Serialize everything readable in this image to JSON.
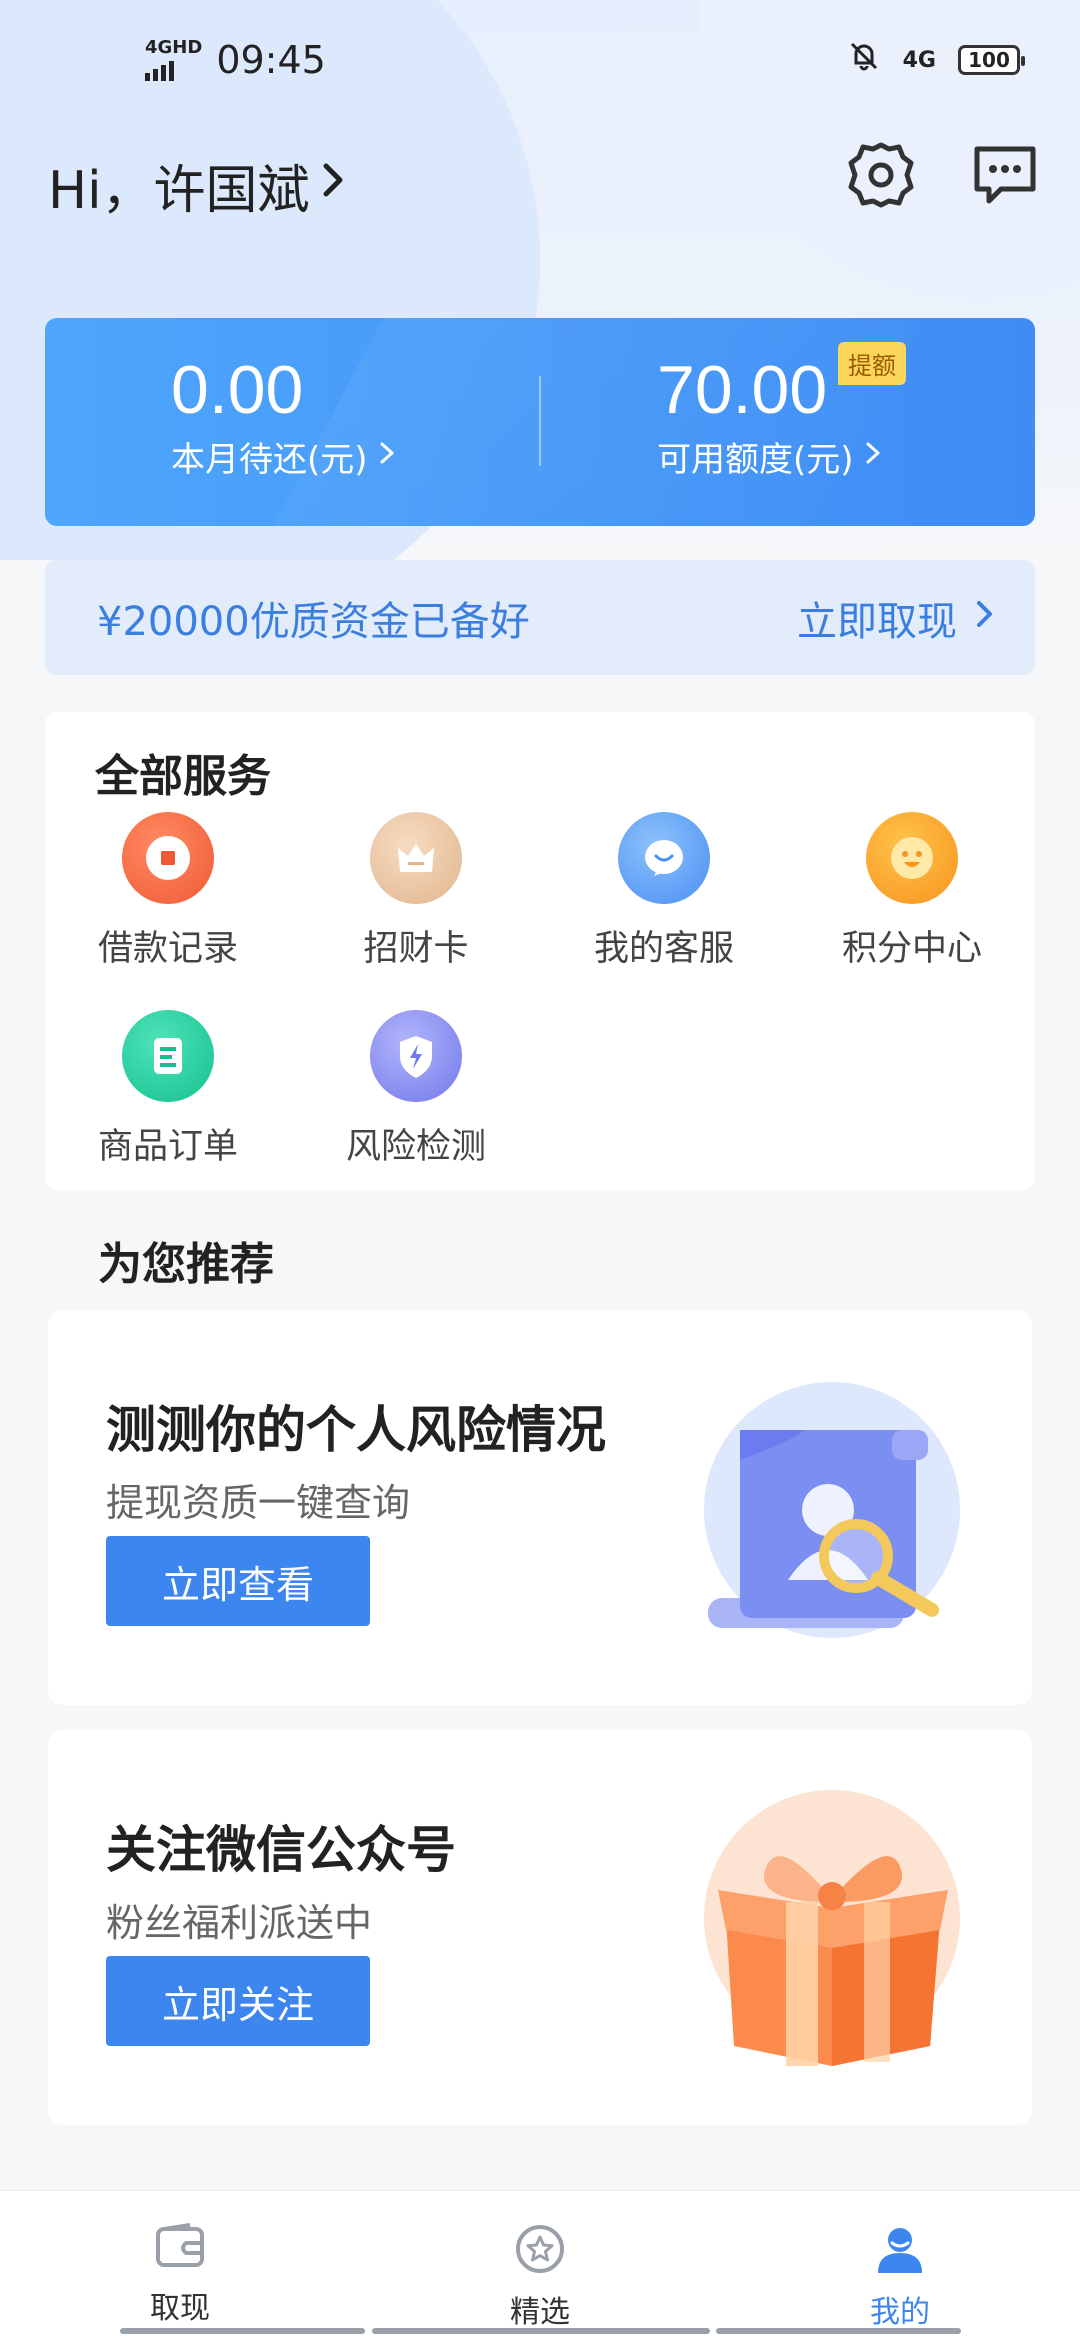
{
  "status_bar": {
    "network_label": "4GHD",
    "time": "09:45",
    "network_right": "4G",
    "battery": "100"
  },
  "header": {
    "greeting": "Hi，许国斌"
  },
  "credit": {
    "repay_amount": "0.00",
    "repay_label": "本月待还(元)",
    "available_amount": "70.00",
    "available_label": "可用额度(元)",
    "badge": "提额"
  },
  "promo": {
    "text": "¥20000优质资金已备好",
    "action": "立即取现"
  },
  "services": {
    "title": "全部服务",
    "items": [
      {
        "label": "借款记录",
        "icon": "loan-record-icon",
        "color": "#f26a45"
      },
      {
        "label": "招财卡",
        "icon": "fortune-card-icon",
        "color": "#e8c4a0"
      },
      {
        "label": "我的客服",
        "icon": "customer-service-icon",
        "color": "#5ea2f6"
      },
      {
        "label": "积分中心",
        "icon": "points-icon",
        "color": "#f7a224"
      },
      {
        "label": "商品订单",
        "icon": "order-icon",
        "color": "#27cfa0"
      },
      {
        "label": "风险检测",
        "icon": "risk-shield-icon",
        "color": "#8a8ef0"
      }
    ]
  },
  "recommend": {
    "title": "为您推荐",
    "cards": [
      {
        "title": "测测你的个人风险情况",
        "subtitle": "提现资质一键查询",
        "button": "立即查看"
      },
      {
        "title": "关注微信公众号",
        "subtitle": "粉丝福利派送中",
        "button": "立即关注"
      }
    ]
  },
  "bottom_nav": {
    "items": [
      {
        "label": "取现",
        "icon": "wallet-icon"
      },
      {
        "label": "精选",
        "icon": "star-icon"
      },
      {
        "label": "我的",
        "icon": "user-icon",
        "active": true
      }
    ]
  },
  "colors": {
    "accent": "#3d86f0",
    "card_gradient_start": "#4ea6fb",
    "card_gradient_end": "#3f8cf5",
    "badge_yellow": "#fcd65a"
  }
}
